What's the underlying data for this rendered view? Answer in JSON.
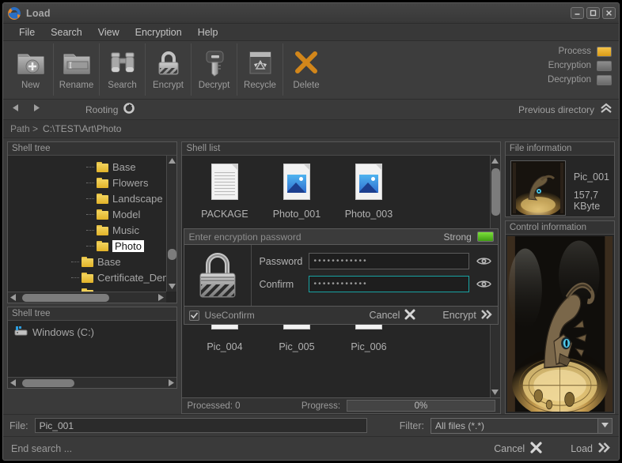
{
  "window": {
    "title": "Load",
    "icon": "app-swirl-icon",
    "controls": {
      "minimize": "minimize-icon",
      "maximize": "maximize-icon",
      "close": "close-icon"
    }
  },
  "menu": {
    "items": [
      "File",
      "Search",
      "View",
      "Encryption",
      "Help"
    ]
  },
  "toolbar": {
    "buttons": [
      {
        "label": "New",
        "icon": "folder-add-icon"
      },
      {
        "label": "Rename",
        "icon": "folder-rename-icon"
      },
      {
        "label": "Search",
        "icon": "binoculars-icon"
      },
      {
        "label": "Encrypt",
        "icon": "padlock-closed-icon"
      },
      {
        "label": "Decrypt",
        "icon": "key-icon"
      },
      {
        "label": "Recycle",
        "icon": "recycle-bin-icon"
      },
      {
        "label": "Delete",
        "icon": "x-cross-icon"
      }
    ],
    "status": [
      {
        "label": "Process",
        "state": "on",
        "color": "#e3ae25"
      },
      {
        "label": "Encryption",
        "state": "off",
        "color": "#7d7d7d"
      },
      {
        "label": "Decryption",
        "state": "off",
        "color": "#7d7d7d"
      }
    ]
  },
  "navbar": {
    "back": "arrow-left-icon",
    "forward": "arrow-right-icon",
    "rooting_label": "Rooting",
    "rooting_icon": "refresh-circle-icon",
    "previous_label": "Previous directory",
    "previous_icon": "double-chevron-up-icon"
  },
  "pathbar": {
    "label": "Path >",
    "value": "C:\\TEST\\Art\\Photo"
  },
  "shell_tree": {
    "header": "Shell tree",
    "items": [
      {
        "label": "Base",
        "indent": 3,
        "selected": false
      },
      {
        "label": "Flowers",
        "indent": 3,
        "selected": false
      },
      {
        "label": "Landscape",
        "indent": 3,
        "selected": false
      },
      {
        "label": "Model",
        "indent": 3,
        "selected": false
      },
      {
        "label": "Music",
        "indent": 3,
        "selected": false
      },
      {
        "label": "Photo",
        "indent": 3,
        "selected": true
      },
      {
        "label": "Base",
        "indent": 2,
        "selected": false
      },
      {
        "label": "Certificate_Demo",
        "indent": 2,
        "selected": false
      }
    ]
  },
  "shell_tree_2": {
    "header": "Shell tree",
    "items": [
      {
        "label": "Windows (C:)",
        "icon": "drive-icon"
      }
    ]
  },
  "shell_list": {
    "header": "Shell list",
    "files_top": [
      {
        "label": "PACKAGE",
        "icon": "document-icon"
      },
      {
        "label": "Photo_001",
        "icon": "image-file-icon"
      },
      {
        "label": "Photo_003",
        "icon": "image-file-icon"
      }
    ],
    "files_bottom": [
      {
        "label": "Pic_004",
        "icon": "image-file-icon"
      },
      {
        "label": "Pic_005",
        "icon": "image-file-icon"
      },
      {
        "label": "Pic_006",
        "icon": "image-file-icon"
      }
    ],
    "status": {
      "processed_label": "Processed: 0",
      "progress_label": "Progress:",
      "progress_value": "0%",
      "progress_percent": 0
    }
  },
  "encryption_dialog": {
    "prompt": "Enter encryption password",
    "strength_label": "Strong",
    "strength_color": "#5cc11e",
    "lock_icon": "padlock-large-icon",
    "password": {
      "label": "Password",
      "value": "••••••••••••",
      "reveal_icon": "eye-icon",
      "focused": false
    },
    "confirm": {
      "label": "Confirm",
      "value": "••••••••••••",
      "reveal_icon": "eye-icon",
      "focused": true
    },
    "use_confirm": {
      "label": "UseConfirm",
      "checked": true
    },
    "cancel": {
      "label": "Cancel",
      "icon": "x-cross-icon"
    },
    "encrypt": {
      "label": "Encrypt",
      "icon": "double-chevron-right-icon"
    }
  },
  "file_information": {
    "header": "File information",
    "name": "Pic_001",
    "size": "157,7 KByte",
    "thumbnail": "steampunk-dragon-thumbnail"
  },
  "control_information": {
    "header": "Control information",
    "preview": "steampunk-dragon-preview"
  },
  "file_bar": {
    "file_label": "File:",
    "file_value": "Pic_001",
    "filter_label": "Filter:",
    "filter_value": "All files (*.*)",
    "filter_caret": "chevron-down-icon"
  },
  "action_bar": {
    "status": "End search ...",
    "cancel": {
      "label": "Cancel",
      "icon": "x-cross-icon"
    },
    "load": {
      "label": "Load",
      "icon": "double-chevron-right-icon"
    }
  }
}
